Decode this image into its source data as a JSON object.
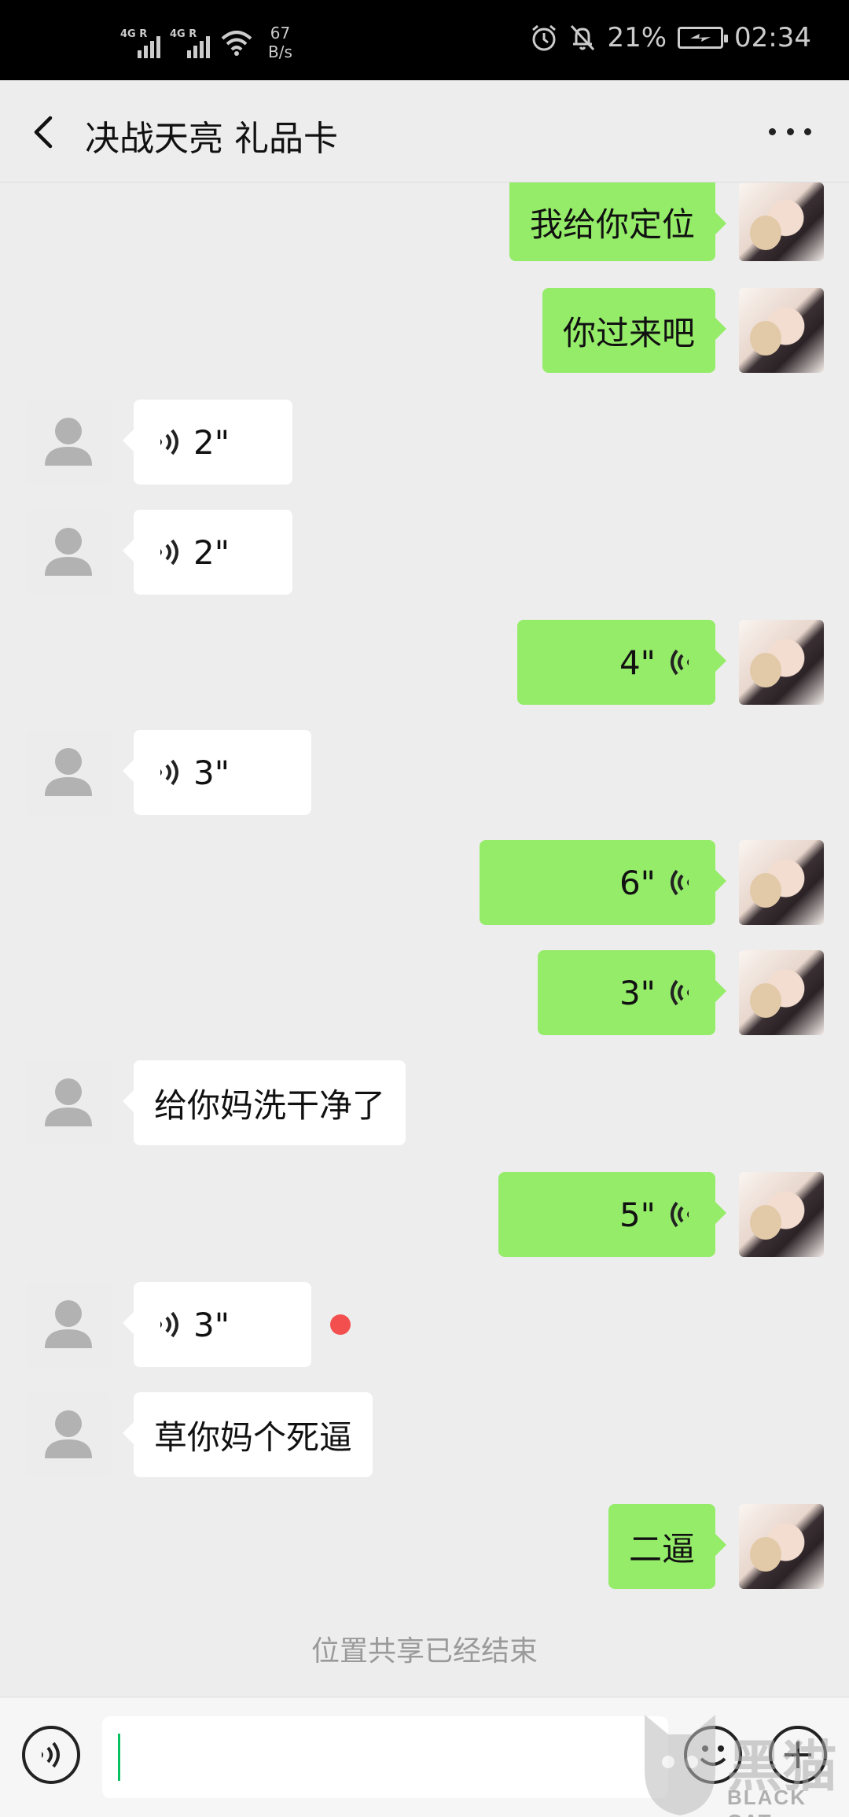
{
  "status_bar": {
    "network_1": "4G R",
    "network_2": "4G R",
    "speed_value": "67",
    "speed_unit": "B/s",
    "battery": "21%",
    "time": "02:34"
  },
  "header": {
    "title": "决战天亮 礼品卡"
  },
  "messages": [
    {
      "side": "out",
      "type": "text",
      "text": "我给你定位"
    },
    {
      "side": "out",
      "type": "text",
      "text": "你过来吧"
    },
    {
      "side": "in",
      "type": "voice",
      "text": "2\""
    },
    {
      "side": "in",
      "type": "voice",
      "text": "2\""
    },
    {
      "side": "out",
      "type": "voice",
      "text": "4\""
    },
    {
      "side": "in",
      "type": "voice",
      "text": "3\""
    },
    {
      "side": "out",
      "type": "voice",
      "text": "6\""
    },
    {
      "side": "out",
      "type": "voice",
      "text": "3\""
    },
    {
      "side": "in",
      "type": "text",
      "text": "给你妈洗干净了"
    },
    {
      "side": "out",
      "type": "voice",
      "text": "5\""
    },
    {
      "side": "in",
      "type": "voice",
      "text": "3\"",
      "unread": true
    },
    {
      "side": "in",
      "type": "text",
      "text": "草你妈个死逼"
    },
    {
      "side": "out",
      "type": "text",
      "text": "二逼"
    }
  ],
  "system_message": "位置共享已经结束",
  "input": {
    "value": ""
  },
  "watermark": {
    "cn": "黑猫",
    "en": "BLACK CAT"
  },
  "colors": {
    "out_bubble": "#95ec69",
    "in_bubble": "#ffffff",
    "background": "#ededed",
    "unread_dot": "#f34f4f",
    "caret": "#07c160"
  }
}
